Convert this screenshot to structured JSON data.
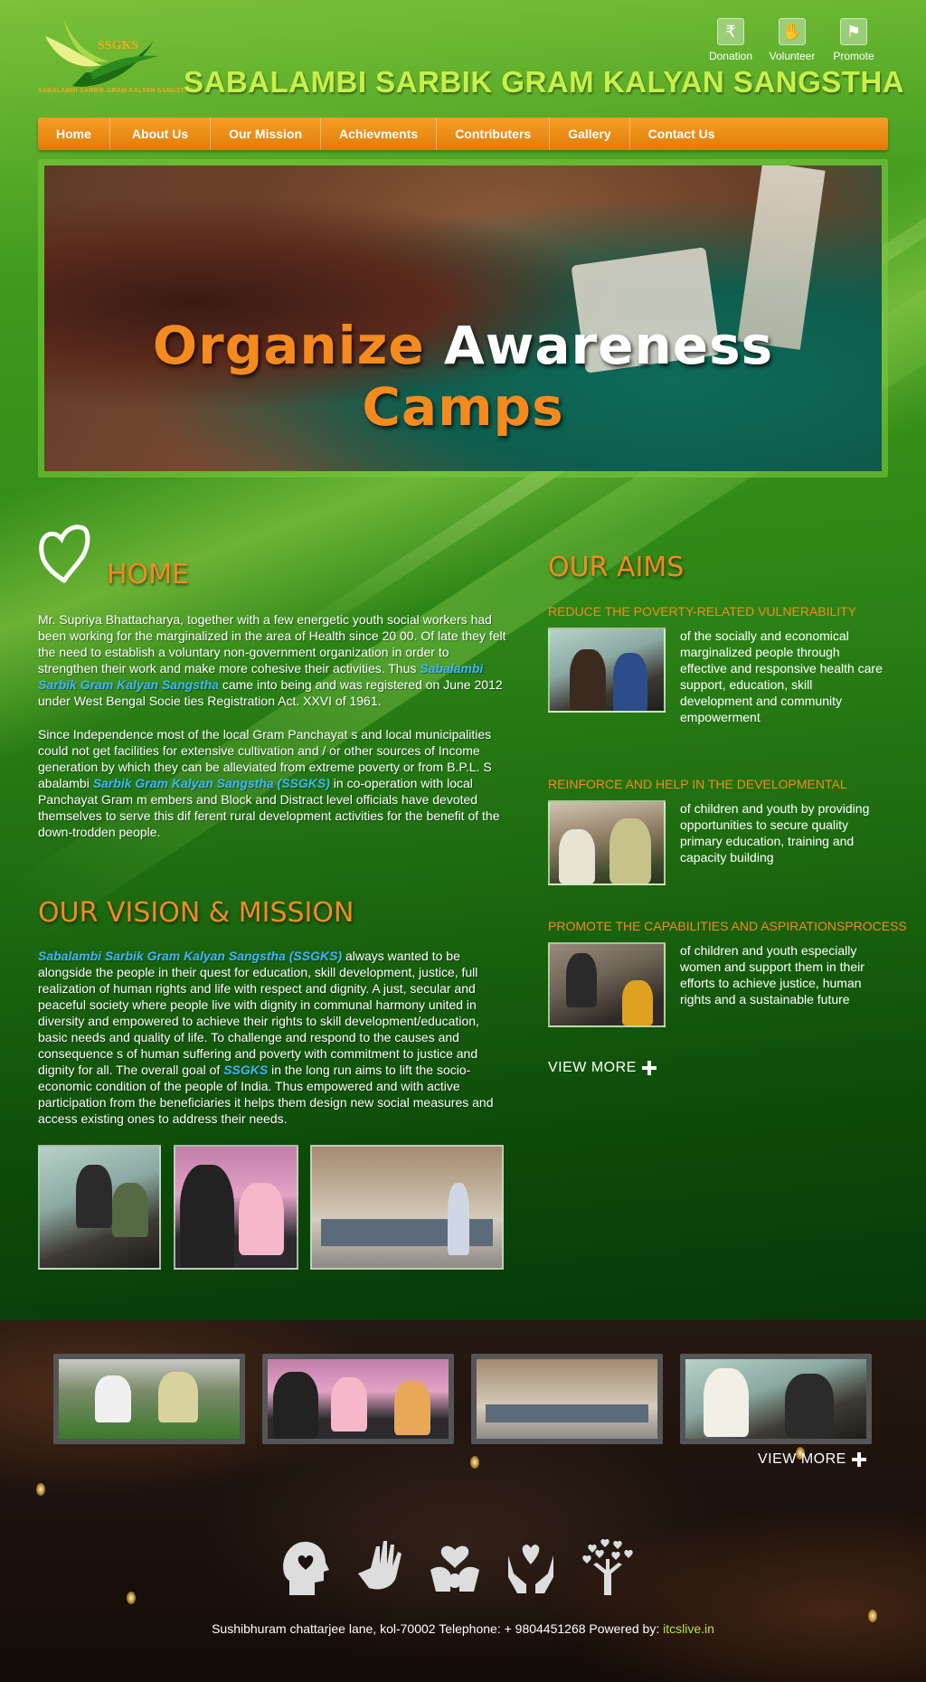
{
  "header": {
    "logo_text": "SSGKS",
    "logo_caption": "SABALAMBI SARBIK GRAM KALYAN SANGSTHA",
    "site_title": "SABALAMBI SARBIK GRAM KALYAN SANGSTHA",
    "actions": [
      {
        "label": "Donation",
        "icon": "rupee-icon"
      },
      {
        "label": "Volunteer",
        "icon": "raised-hands-icon"
      },
      {
        "label": "Promote",
        "icon": "promote-icon"
      }
    ]
  },
  "nav": {
    "items": [
      "Home",
      "About Us",
      "Our Mission",
      "Achievments",
      "Contributers",
      "Gallery",
      "Contact Us"
    ]
  },
  "hero": {
    "word1": "Organize",
    "word2": "Awareness",
    "word3": "Camps"
  },
  "home": {
    "title": "HOME",
    "p1_a": "Mr. Supriya Bhattacharya, together with a few energetic youth social workers had been working for the marginalized in the area of Health since 20 00. Of late they felt the need to establish a voluntary non-government organization in order to strengthen their work and make more cohesive their activities. Thus ",
    "p1_org": "Sabalambi Sarbik Gram Kalyan Sangstha",
    "p1_b": " came into being and was registered on June 2012 under West Bengal Socie ties Registration Act. XXVI of 1961.",
    "p2_a": "Since Independence most of the local Gram Panchayat s and local municipalities could not get facilities for extensive cultivation and / or other sources of Income generation by which they can be alleviated from extreme poverty or from B.P.L. S abalambi ",
    "p2_org": "Sarbik Gram Kalyan Sangstha (SSGKS)",
    "p2_b": " in co-operation with local Panchayat Gram m embers and Block and Distract level officials have devoted themselves to serve this dif ferent rural development activities for the benefit of the down-trodden people."
  },
  "vision": {
    "title": "OUR VISION & MISSION",
    "org": "Sabalambi Sarbik Gram Kalyan Sangstha (SSGKS)",
    "text_a": " always wanted to be alongside the people in their quest for education, skill development, justice, full realization of human rights and life with respect and dignity. A just, secular and peaceful society where people live with dignity in communal harmony united in diversity and empowered to achieve their rights to skill development/education, basic needs and quality of life. To challenge and respond to the causes and consequence s of human suffering and poverty with commitment to justice and dignity for all. The overall goal of ",
    "org_short": "SSGKS",
    "text_b": "  in the long run aims to lift the socio-economic condition of the people of India. Thus empowered and with active participation from the beneficiaries it helps them design new social measures and access existing ones to address their needs."
  },
  "aims": {
    "title": "OUR AIMS",
    "items": [
      {
        "heading": "REDUCE THE POVERTY-RELATED VULNERABILITY",
        "text": "of the socially and economical marginalized people through effective and responsive health care support, education, skill development and community empowerment"
      },
      {
        "heading": "REINFORCE AND HELP IN THE DEVELOPMENTAL",
        "text": "of children and youth by providing opportunities to secure quality primary education, training and capacity building"
      },
      {
        "heading": "PROMOTE THE CAPABILITIES AND ASPIRATIONSPROCESS",
        "text": "of children and youth especially women and support them in their efforts to achieve justice, human rights and a sustainable future"
      }
    ],
    "view_more": "VIEW MORE"
  },
  "gallery": {
    "view_more": "VIEW MORE"
  },
  "footer": {
    "address": "Sushibhuram chattarjee lane, kol-70002 Telephone: + 9804451268 Powered by: ",
    "powered_by": "itcslive.in",
    "icons": [
      "head-heart-icon",
      "helping-hand-icon",
      "hands-heart-icon",
      "care-hands-icon",
      "heart-tree-icon"
    ]
  },
  "colors": {
    "title_green": "#c8f04a",
    "accent_orange": "#f58a1f",
    "org_blue": "#3fb7ff",
    "nav_orange": "#f7a028"
  }
}
